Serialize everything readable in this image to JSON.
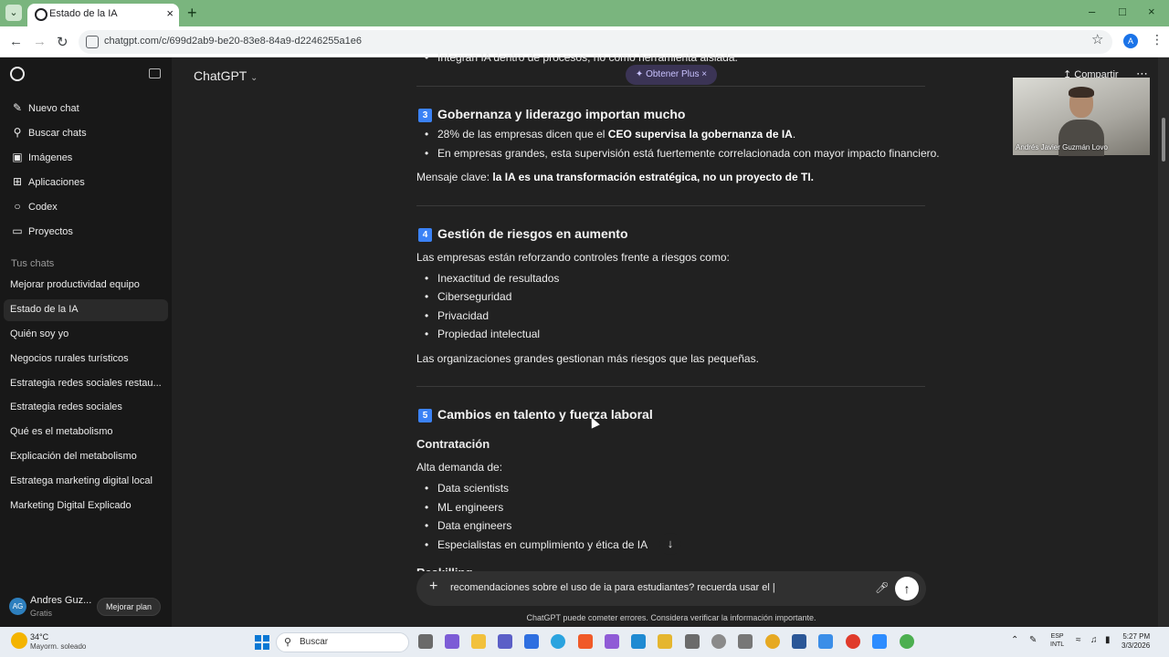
{
  "browser": {
    "tab_title": "Estado de la IA",
    "url": "chatgpt.com/c/699d2ab9-be20-83e8-84a9-d2246255a1e6",
    "profile_initial": "A"
  },
  "sidebar": {
    "nav": [
      {
        "label": "Nuevo chat",
        "icon": "edit-icon"
      },
      {
        "label": "Buscar chats",
        "icon": "search-icon"
      },
      {
        "label": "Imágenes",
        "icon": "image-icon"
      },
      {
        "label": "Aplicaciones",
        "icon": "apps-icon"
      },
      {
        "label": "Codex",
        "icon": "codex-icon"
      },
      {
        "label": "Proyectos",
        "icon": "folder-icon"
      }
    ],
    "section_label": "Tus chats",
    "chats": [
      "Mejorar productividad equipo",
      "Estado de la IA",
      "Quién soy yo",
      "Negocios rurales turísticos",
      "Estrategia redes sociales restau...",
      "Estrategia redes sociales",
      "Qué es el metabolismo",
      "Explicación del metabolismo",
      "Estratega marketing digital local",
      "Marketing Digital Explicado"
    ],
    "active_chat": "Estado de la IA",
    "user": {
      "initials": "AG",
      "name": "Andres Guz...",
      "plan": "Gratis",
      "upgrade_label": "Mejorar plan"
    }
  },
  "header": {
    "model": "ChatGPT",
    "plus_pill": "Obtener Plus",
    "share": "Compartir"
  },
  "content": {
    "top_clipped": "Integran IA dentro de procesos, no como herramienta aislada.",
    "section3": {
      "num": "3",
      "title": "Gobernanza y liderazgo importan mucho",
      "b1_pre": "28% de las empresas dicen que el ",
      "b1_bold": "CEO supervisa la gobernanza de IA",
      "b1_post": ".",
      "b2": "En empresas grandes, esta supervisión está fuertemente correlacionada con mayor impacto financiero.",
      "key_pre": "Mensaje clave: ",
      "key_bold": "la IA es una transformación estratégica, no un proyecto de TI."
    },
    "section4": {
      "num": "4",
      "title": "Gestión de riesgos en aumento",
      "intro": "Las empresas están reforzando controles frente a riesgos como:",
      "items": [
        "Inexactitud de resultados",
        "Ciberseguridad",
        "Privacidad",
        "Propiedad intelectual"
      ],
      "outro": "Las organizaciones grandes gestionan más riesgos que las pequeñas."
    },
    "section5": {
      "num": "5",
      "title": "Cambios en talento y fuerza laboral",
      "subhead": "Contratación",
      "intro": "Alta demanda de:",
      "items": [
        "Data scientists",
        "ML engineers",
        "Data engineers",
        "Especialistas en cumplimiento y ética de IA"
      ],
      "clipped": "Reskilling"
    }
  },
  "composer": {
    "text": "recomendaciones sobre el uso de ia para estudiantes? recuerda usar el |",
    "disclaimer": "ChatGPT puede cometer errores. Considera verificar la información importante."
  },
  "video": {
    "name": "Andrés Javier Guzmán Lovo"
  },
  "taskbar": {
    "weather_temp": "34°C",
    "weather_desc": "Mayorm. soleado",
    "search": "Buscar",
    "lang_1": "ESP",
    "lang_2": "INTL",
    "time": "5:27 PM",
    "date": "3/3/2026"
  },
  "colors": {
    "background": "#212121",
    "sidebar": "#181818",
    "accent": "#3b82f6",
    "tabbar": "#7ab57e"
  }
}
